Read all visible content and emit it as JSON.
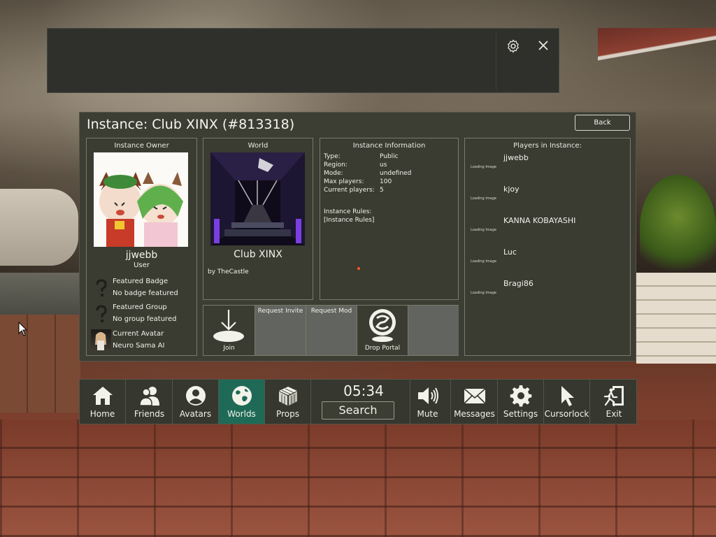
{
  "panel": {
    "title": "Instance: Club XINX (#813318)",
    "back_label": "Back"
  },
  "owner": {
    "heading": "Instance Owner",
    "name": "jjwebb",
    "role": "User",
    "badge_title": "Featured Badge",
    "badge_value": "No badge featured",
    "group_title": "Featured Group",
    "group_value": "No group featured",
    "avatar_title": "Current Avatar",
    "avatar_value": "Neuro Sama AI"
  },
  "world": {
    "heading": "World",
    "name": "Club XINX",
    "author": "by TheCastle"
  },
  "info": {
    "heading": "Instance Information",
    "rows": [
      {
        "key": "Type:",
        "value": "Public"
      },
      {
        "key": "Region:",
        "value": "us"
      },
      {
        "key": "Mode:",
        "value": "undefined"
      },
      {
        "key": "Max players:",
        "value": "100"
      },
      {
        "key": "Current players:",
        "value": "5"
      }
    ],
    "rules_title": "Instance Rules:",
    "rules_value": "[Instance Rules]"
  },
  "actions": {
    "join": "Join",
    "request_invite": "Request Invite",
    "request_mod": "Request Mod",
    "drop_portal": "Drop Portal"
  },
  "players": {
    "heading": "Players in Instance:",
    "loading_text": "Loading Image",
    "list": [
      "jjwebb",
      "kjoy",
      "KANNA KOBAYASHI",
      "Luc",
      "Bragi86"
    ]
  },
  "nav": {
    "home": "Home",
    "friends": "Friends",
    "avatars": "Avatars",
    "worlds": "Worlds",
    "props": "Props",
    "time": "05:34",
    "search": "Search",
    "mute": "Mute",
    "messages": "Messages",
    "settings": "Settings",
    "cursorlock": "Cursorlock",
    "exit": "Exit",
    "active": "worlds"
  },
  "colors": {
    "panel_bg": "#3c3d33",
    "active_tab": "#1f6a56",
    "rule_dot": "#ff5a1e"
  },
  "icons": [
    "gear-icon",
    "close-icon",
    "question-icon",
    "join-arrow-icon",
    "portal-icon",
    "home-icon",
    "friends-icon",
    "avatar-icon",
    "globe-icon",
    "cube-icon",
    "speaker-icon",
    "envelope-icon",
    "settings-gear-icon",
    "cursor-icon",
    "exit-icon"
  ]
}
